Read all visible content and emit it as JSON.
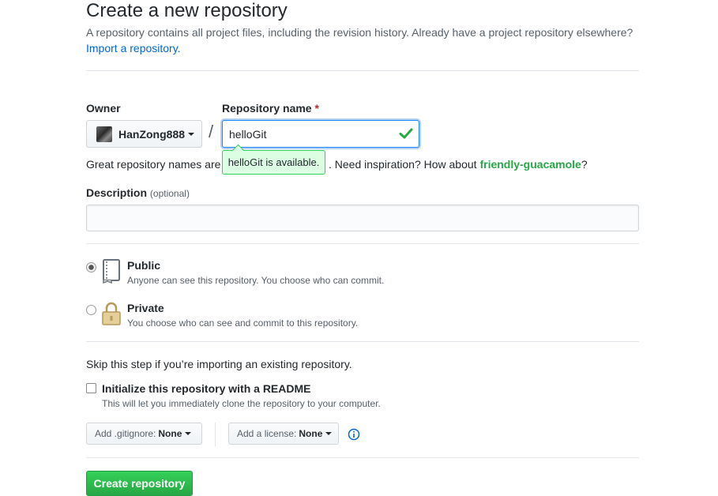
{
  "header": {
    "title": "Create a new repository",
    "subtitle": "A repository contains all project files, including the revision history. Already have a project repository elsewhere?",
    "import_link": "Import a repository."
  },
  "owner": {
    "label": "Owner",
    "name": "HanZong888"
  },
  "repo": {
    "label": "Repository name",
    "required_mark": "*",
    "value": "helloGit",
    "available_tooltip": "helloGit is available.",
    "hint_prefix": "Great repository names are",
    "hint_mid": ". Need inspiration? How about",
    "suggestion": "friendly-guacamole",
    "hint_suffix": "?"
  },
  "description": {
    "label": "Description",
    "optional": "(optional)",
    "value": ""
  },
  "visibility": {
    "selected": "public",
    "options": [
      {
        "id": "public",
        "title": "Public",
        "note": "Anyone can see this repository. You choose who can commit."
      },
      {
        "id": "private",
        "title": "Private",
        "note": "You choose who can see and commit to this repository."
      }
    ]
  },
  "init": {
    "skip_text": "Skip this step if you’re importing an existing repository.",
    "readme_label": "Initialize this repository with a README",
    "readme_note": "This will let you immediately clone the repository to your computer.",
    "readme_checked": false,
    "gitignore_key": "Add .gitignore:",
    "gitignore_value": "None",
    "license_key": "Add a license:",
    "license_value": "None"
  },
  "submit": {
    "label": "Create repository"
  },
  "colors": {
    "accent": "#0366d6",
    "success": "#28a745",
    "required": "#cb2431"
  },
  "icons": [
    "avatar",
    "caret-down-icon",
    "check-icon",
    "book-icon",
    "lock-icon",
    "info-icon"
  ]
}
